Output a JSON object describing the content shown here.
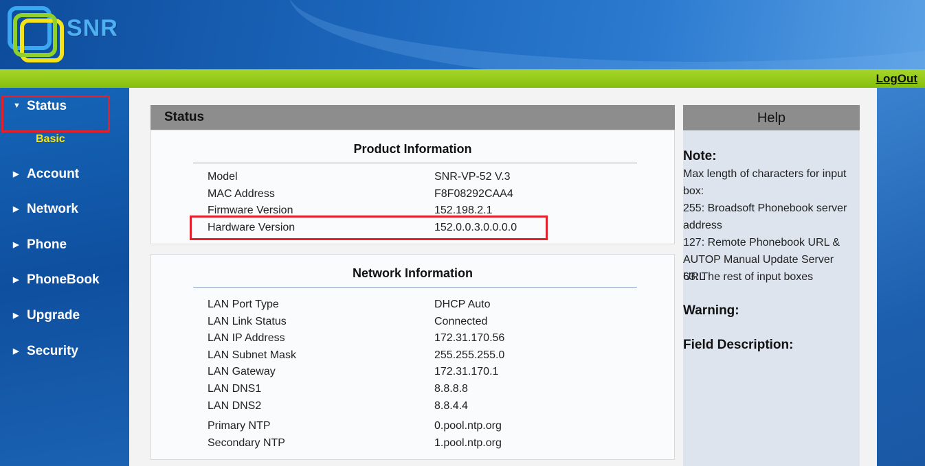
{
  "brand": {
    "logo_text": "SNR"
  },
  "topbar": {
    "logout_label": "LogOut"
  },
  "sidebar": {
    "items": [
      {
        "label": "Status"
      },
      {
        "label": "Account"
      },
      {
        "label": "Network"
      },
      {
        "label": "Phone"
      },
      {
        "label": "PhoneBook"
      },
      {
        "label": "Upgrade"
      },
      {
        "label": "Security"
      }
    ],
    "sub_item": "Basic"
  },
  "status_panel": {
    "title": "Status",
    "product": {
      "title": "Product Information",
      "rows": [
        {
          "key": "Model",
          "value": "SNR-VP-52 V.3"
        },
        {
          "key": "MAC Address",
          "value": "F8F08292CAA4"
        },
        {
          "key": "Firmware Version",
          "value": "152.198.2.1"
        },
        {
          "key": "Hardware Version",
          "value": "152.0.0.3.0.0.0.0"
        }
      ]
    },
    "network": {
      "title": "Network Information",
      "rows": [
        {
          "key": "LAN Port Type",
          "value": "DHCP Auto"
        },
        {
          "key": "LAN Link Status",
          "value": "Connected"
        },
        {
          "key": "LAN IP Address",
          "value": "172.31.170.56"
        },
        {
          "key": "LAN Subnet Mask",
          "value": "255.255.255.0"
        },
        {
          "key": "LAN Gateway",
          "value": "172.31.170.1"
        },
        {
          "key": "LAN DNS1",
          "value": "8.8.8.8"
        },
        {
          "key": "LAN DNS2",
          "value": "8.8.4.4"
        },
        {
          "key": "Primary NTP",
          "value": "0.pool.ntp.org"
        },
        {
          "key": "Secondary NTP",
          "value": "1.pool.ntp.org"
        }
      ]
    }
  },
  "help_panel": {
    "title": "Help",
    "note_heading": "Note:",
    "note_lines": [
      "Max length of characters for input",
      "box:",
      "255: Broadsoft Phonebook server",
      "address",
      "127: Remote Phonebook URL &",
      "AUTOP Manual Update Server URL",
      "63: The rest of input boxes"
    ],
    "warning_heading": "Warning:",
    "field_heading": "Field Description:"
  },
  "colors": {
    "header_blue": "#1b66bb",
    "green_bar": "#86bf0c",
    "highlight_red": "#e0202a",
    "sub_item_yellow": "#f5e51a"
  }
}
